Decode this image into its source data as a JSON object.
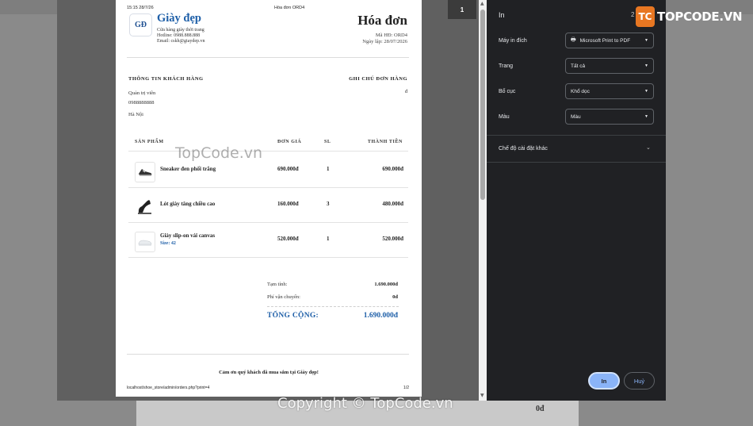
{
  "background": {
    "visible_value": "0đ"
  },
  "preview": {
    "header_time": "15:15 28/7/26",
    "header_doc": "Hóa đơn ORD4",
    "logo_text": "GĐ",
    "brand": "Giày đẹp",
    "tagline": "Cửa hàng giày thời trang",
    "hotline": "Hotline: 0988.888.888",
    "email": "Email: cskh@giaydep.vn",
    "invoice_title": "Hóa đơn",
    "invoice_no": "Mã HĐ: ORD4",
    "invoice_date": "Ngày lập: 28/07/2026",
    "customer_heading": "THÔNG TIN KHÁCH HÀNG",
    "notes_heading": "GHI CHÚ ĐƠN HÀNG",
    "customer_name": "Quản trị viên",
    "customer_phone": "0988888888",
    "customer_address": "Hà Nội",
    "notes_value": "đ",
    "columns": {
      "product": "SẢN PHẨM",
      "unit_price": "ĐƠN GIÁ",
      "qty": "SL",
      "total": "THÀNH TIỀN"
    },
    "items": [
      {
        "name": "Sneaker đen phối trắng",
        "size": "",
        "price": "690.000đ",
        "qty": "1",
        "total": "690.000đ",
        "icon": "sneaker-icon"
      },
      {
        "name": "Lót giày tăng chiều cao",
        "size": "",
        "price": "160.000đ",
        "qty": "3",
        "total": "480.000đ",
        "icon": "insole-icon"
      },
      {
        "name": "Giày slip-on vải canvas",
        "size": "Size: 42",
        "price": "520.000đ",
        "qty": "1",
        "total": "520.000đ",
        "icon": "slipon-icon"
      }
    ],
    "subtotal_label": "Tạm tính:",
    "subtotal_value": "1.690.000đ",
    "shipping_label": "Phí vận chuyển:",
    "shipping_value": "0đ",
    "grand_label": "TỔNG CỘNG:",
    "grand_value": "1.690.000đ",
    "thanks": "Cảm ơn quý khách đã mua sắm tại Giày đẹp!",
    "footer_url": "localhost/shoe_store/admin/orders.php?print=4",
    "footer_page": "1/2",
    "page_badge": "1"
  },
  "dialog": {
    "title": "In",
    "sheet_count": "2",
    "destination_label": "Máy in đích",
    "destination_value": "Microsoft Print to PDF",
    "pages_label": "Trang",
    "pages_value": "Tất cả",
    "layout_label": "Bố cục",
    "layout_value": "Khổ dọc",
    "color_label": "Màu",
    "color_value": "Màu",
    "more_settings": "Chế độ cài đặt khác",
    "print_button": "In",
    "cancel_button": "Huỷ"
  },
  "watermarks": {
    "logo_badge": "TC",
    "logo_text": "TOPCODE.VN",
    "middle": "TopCode.vn",
    "bottom": "Copyright © TopCode.vn"
  },
  "colors": {
    "brand_blue": "#1e5fa8",
    "dialog_bg": "#202124",
    "print_button": "#8ab4f8"
  }
}
